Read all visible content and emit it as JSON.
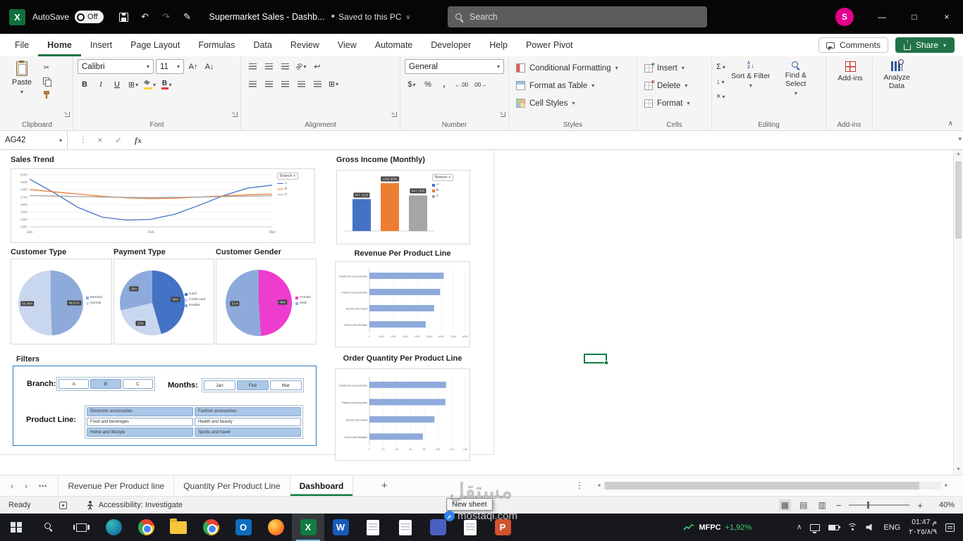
{
  "titlebar": {
    "autosave_label": "AutoSave",
    "autosave_state": "Off",
    "doc_title": "Supermarket Sales - Dashb...",
    "saved_separator": "•",
    "saved_status": "Saved to this PC",
    "search_placeholder": "Search",
    "avatar_initial": "S"
  },
  "icons": {
    "undo": "↶",
    "redo": "↷",
    "pen": "✎",
    "chevron_down": "∨",
    "dropdown": "▾",
    "minimize": "—",
    "maximize": "□",
    "close": "×",
    "cancel": "×",
    "check": "✓",
    "bold": "B",
    "italic": "I",
    "underline": "U",
    "font_grow": "A↑",
    "font_shrink": "A↓",
    "sum": "Σ",
    "fill_arrow": "↓",
    "clear": "×",
    "percent": "%",
    "comma": ",",
    "currency": "$",
    "merge": "⊞",
    "borders": "⊞",
    "wrap": "↩",
    "orientation": "ab",
    "dec_left": "←.00",
    "dec_right": ".00→",
    "nav_left": "‹",
    "nav_right": "›",
    "more_sheets": "•••",
    "new_sheet": "+",
    "kebab": "⋮",
    "scroll_up": "▲",
    "scroll_down": "▼",
    "scroll_left": "◄",
    "scroll_right": "►",
    "collapse_ribbon": "∧",
    "tray_chevron": "∧",
    "view_normal": "▦",
    "view_page_layout": "▤",
    "view_page_break": "▥",
    "zoom_out": "−",
    "zoom_in": "+"
  },
  "ribbon_tabs": [
    {
      "label": "File",
      "active": false
    },
    {
      "label": "Home",
      "active": true
    },
    {
      "label": "Insert",
      "active": false
    },
    {
      "label": "Page Layout",
      "active": false
    },
    {
      "label": "Formulas",
      "active": false
    },
    {
      "label": "Data",
      "active": false
    },
    {
      "label": "Review",
      "active": false
    },
    {
      "label": "View",
      "active": false
    },
    {
      "label": "Automate",
      "active": false
    },
    {
      "label": "Developer",
      "active": false
    },
    {
      "label": "Help",
      "active": false
    },
    {
      "label": "Power Pivot",
      "active": false
    }
  ],
  "ribbon_actions": {
    "comments": "Comments",
    "share": "Share"
  },
  "ribbon": {
    "clipboard": {
      "label": "Clipboard",
      "paste": "Paste"
    },
    "font": {
      "label": "Font",
      "family": "Calibri",
      "size": "11"
    },
    "alignment": {
      "label": "Alignment"
    },
    "number": {
      "label": "Number",
      "format": "General"
    },
    "styles": {
      "label": "Styles",
      "items": [
        "Conditional Formatting",
        "Format as Table",
        "Cell Styles"
      ]
    },
    "cells": {
      "label": "Cells",
      "items": [
        "Insert",
        "Delete",
        "Format"
      ]
    },
    "editing": {
      "label": "Editing",
      "sort_filter": "Sort & Filter",
      "find_select": "Find & Select"
    },
    "addins": {
      "label": "Add-ins",
      "button": "Add-ins"
    },
    "analyze": {
      "button": "Analyze Data"
    }
  },
  "formula_bar": {
    "name_box": "AG42",
    "fx": "fx",
    "value": ""
  },
  "chart_data": [
    {
      "id": "sales-trend",
      "type": "line",
      "title": "Sales Trend",
      "x_labels": [
        "Jan",
        "Feb",
        "Mar"
      ],
      "ylim": [
        1300,
        2000
      ],
      "yticks": [
        1300,
        1400,
        1500,
        1600,
        1700,
        1800,
        1900,
        2000
      ],
      "filter_button": "Branch",
      "legend_position": "right",
      "grid": true,
      "series": [
        {
          "name": "A",
          "color": "#4472c4",
          "values": [
            1940,
            1760,
            1560,
            1430,
            1390,
            1400,
            1470,
            1590,
            1720,
            1820,
            1860
          ]
        },
        {
          "name": "B",
          "color": "#ed7d31",
          "values": [
            1800,
            1770,
            1740,
            1710,
            1690,
            1680,
            1685,
            1700,
            1715,
            1730,
            1740
          ]
        },
        {
          "name": "C",
          "color": "#a5a5a5",
          "values": [
            1720,
            1714,
            1706,
            1700,
            1695,
            1692,
            1695,
            1700,
            1706,
            1712,
            1718
          ]
        }
      ]
    },
    {
      "id": "gross-income",
      "type": "bar",
      "title": "Gross Income (Monthly)",
      "categories": [
        "A",
        "B",
        "C"
      ],
      "values": [
        847.1628,
        1269.5835,
        944.7355
      ],
      "value_labels": [
        "847.1628",
        "1269.5835",
        "944.7355"
      ],
      "colors": [
        "#4472c4",
        "#ed7d31",
        "#a5a5a5"
      ],
      "legend": [
        "A",
        "B",
        "C"
      ],
      "filter_button": "Branch"
    },
    {
      "id": "customer-type",
      "type": "pie",
      "title": "Customer Type",
      "slices": [
        {
          "name": "Member",
          "value": 49.51,
          "label": "49,51%",
          "color": "#8eaadb"
        },
        {
          "name": "Normal",
          "value": 50.49,
          "label": "50,49%",
          "color": "#c9d7ee"
        }
      ]
    },
    {
      "id": "payment-type",
      "type": "pie",
      "title": "Payment Type",
      "slices": [
        {
          "name": "Cash",
          "value": 46,
          "label": "46%",
          "color": "#4472c4"
        },
        {
          "name": "Credit card",
          "value": 26,
          "label": "26%",
          "color": "#c9d7ee"
        },
        {
          "name": "Ewallet",
          "value": 29,
          "label": "29%",
          "color": "#8eaadb"
        }
      ]
    },
    {
      "id": "customer-gender",
      "type": "pie",
      "title": "Customer Gender",
      "slices": [
        {
          "name": "Female",
          "value": 49,
          "label": "49%",
          "color": "#ee3ccf"
        },
        {
          "name": "Male",
          "value": 51,
          "label": "51%",
          "color": "#8eaadb"
        }
      ]
    },
    {
      "id": "revenue-product-line",
      "type": "bar",
      "orientation": "horizontal",
      "title": "Revenue Per Product Line",
      "categories": [
        "Electronic accessories",
        "Fashion accessories",
        "Sports and travel",
        "Home and lifestyle"
      ],
      "values": [
        6200,
        5900,
        5400,
        4700
      ],
      "xticks": [
        0,
        1000,
        2000,
        3000,
        4000,
        5000,
        6000,
        7000,
        8000
      ],
      "bar_color": "#8eaadb",
      "grid": true
    },
    {
      "id": "order-quantity-product-line",
      "type": "bar",
      "orientation": "horizontal",
      "title": "Order Quantity Per Product Line",
      "categories": [
        "Electronic accessories",
        "Fashion accessories",
        "Sports and travel",
        "Home and lifestyle"
      ],
      "values": [
        112,
        111,
        95,
        78
      ],
      "xticks": [
        0,
        20,
        40,
        60,
        80,
        100,
        120,
        140
      ],
      "bar_color": "#8eaadb",
      "grid": true
    }
  ],
  "filters": {
    "title": "Filters",
    "branch": {
      "label": "Branch:",
      "options": [
        {
          "label": "A",
          "selected": false
        },
        {
          "label": "B",
          "selected": true
        },
        {
          "label": "C",
          "selected": false
        }
      ]
    },
    "months": {
      "label": "Months:",
      "options": [
        {
          "label": "Jan",
          "selected": false
        },
        {
          "label": "Feb",
          "selected": true
        },
        {
          "label": "Mar",
          "selected": false
        }
      ]
    },
    "product_line": {
      "label": "Product Line:",
      "options": [
        {
          "label": "Electronic accessories",
          "selected": true
        },
        {
          "label": "Fashion accessories",
          "selected": true
        },
        {
          "label": "Food and beverages",
          "selected": false
        },
        {
          "label": "Health and beauty",
          "selected": false
        },
        {
          "label": "Home and lifestyle",
          "selected": true
        },
        {
          "label": "Sports and travel",
          "selected": true
        }
      ]
    }
  },
  "sheet_tabs": {
    "tabs": [
      {
        "label": "Revenue Per Product line",
        "active": false
      },
      {
        "label": "Quantity Per Product Line",
        "active": false
      },
      {
        "label": "Dashboard",
        "active": true
      }
    ],
    "new_sheet_tooltip": "New sheet"
  },
  "status_bar": {
    "ready": "Ready",
    "accessibility": "Accessibility: Investigate",
    "zoom": "40%"
  },
  "taskbar": {
    "stock": {
      "symbol": "MFPC",
      "change": "+1,92%",
      "change_color": "#3fcf6e"
    },
    "language": "ENG",
    "time": "01:47 م",
    "date": "٢٠٢٥/٨/٩",
    "apps": [
      {
        "name": "edge",
        "type": "circle",
        "color1": "#35bdb2",
        "color2": "#0c59a4"
      },
      {
        "name": "chrome",
        "type": "chrome"
      },
      {
        "name": "file-explorer",
        "type": "folder"
      },
      {
        "name": "chrome-profile",
        "type": "chrome"
      },
      {
        "name": "outlook",
        "type": "square",
        "color": "#0f6cbd",
        "letter": "O"
      },
      {
        "name": "firefox",
        "type": "firefox"
      },
      {
        "name": "excel",
        "type": "square",
        "color": "#107c41",
        "letter": "X",
        "active": true
      },
      {
        "name": "word",
        "type": "square",
        "color": "#185abd",
        "letter": "W"
      },
      {
        "name": "notepad",
        "type": "doc"
      },
      {
        "name": "text-document",
        "type": "doc"
      },
      {
        "name": "app-blue",
        "type": "square",
        "color": "#4a5fc1",
        "letter": ""
      },
      {
        "name": "text-document-2",
        "type": "doc"
      },
      {
        "name": "powerpoint",
        "type": "square",
        "color": "#d35230",
        "letter": "P"
      }
    ]
  },
  "watermark": {
    "word": "مستقل",
    "domain": "mostaql.com"
  }
}
